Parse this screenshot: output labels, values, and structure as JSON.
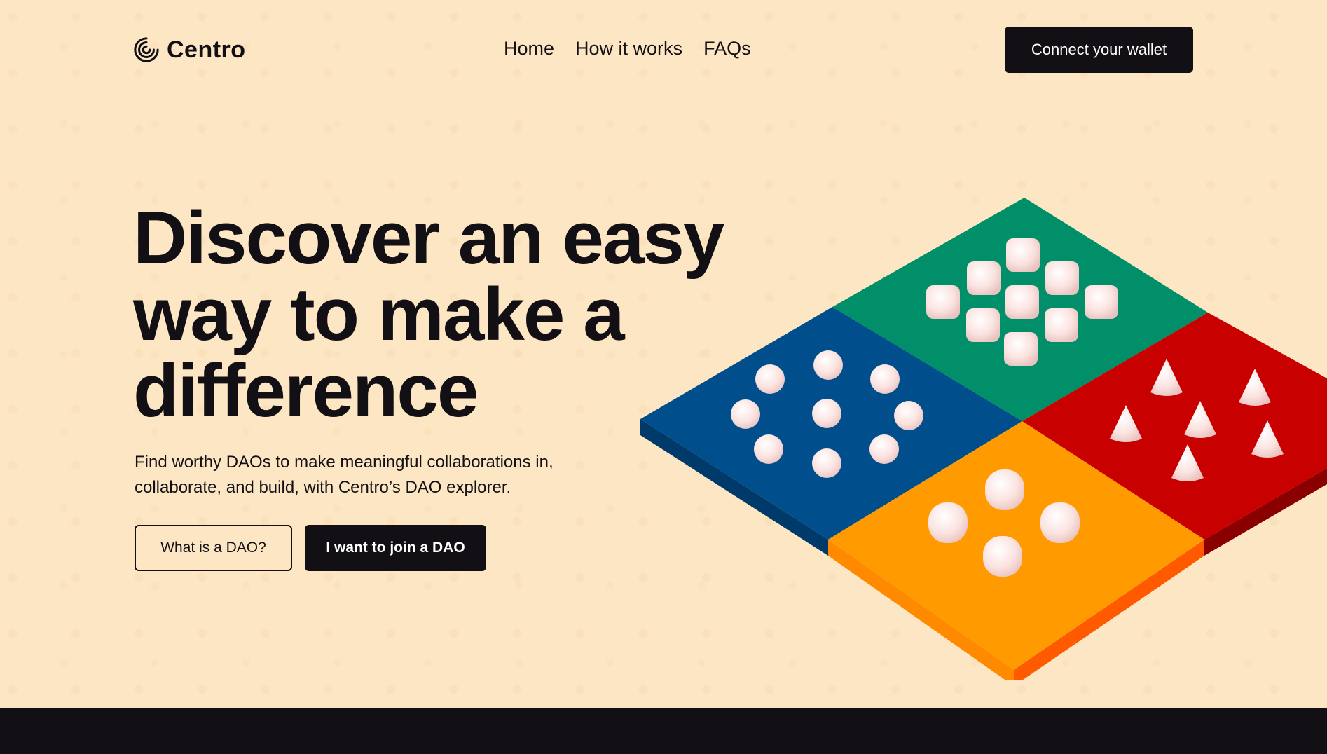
{
  "brand": {
    "name": "Centro",
    "logo_icon": "spiral-logo-icon"
  },
  "nav": {
    "items": [
      {
        "label": "Home"
      },
      {
        "label": "How it works"
      },
      {
        "label": "FAQs"
      }
    ]
  },
  "header": {
    "connect_label": "Connect your wallet"
  },
  "hero": {
    "title": "Discover an easy way to make a difference",
    "subtitle": "Find worthy DAOs to make meaningful collaborations in, collaborate, and build, with Centro’s DAO explorer.",
    "secondary_label": "What is a DAO?",
    "primary_label": "I want to join a DAO"
  },
  "colors": {
    "background": "#fde6c4",
    "dark": "#121014",
    "tile_green": "#008f68",
    "tile_blue": "#004f8c",
    "tile_red": "#c90000",
    "tile_orange": "#ff9b00"
  }
}
